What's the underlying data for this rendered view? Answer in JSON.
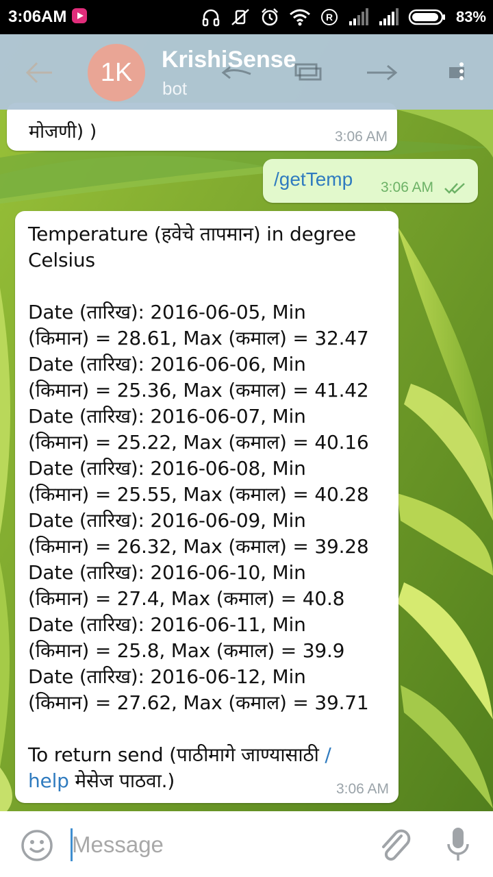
{
  "status_bar": {
    "time": "3:06AM",
    "battery_percent": "83%",
    "icons": [
      "media-app-icon",
      "headphones-icon",
      "mute-icon",
      "alarm-icon",
      "wifi-icon",
      "roaming-icon",
      "signal-icon",
      "signal-icon",
      "battery-icon"
    ]
  },
  "header": {
    "avatar_initials": "1K",
    "title": "KrishiSense",
    "subtitle": "bot",
    "avatar_color": "#e9a595",
    "bar_color": "#afc5d6"
  },
  "messages": {
    "previous": {
      "text": "मोजणी) )",
      "time": "3:06 AM"
    },
    "outgoing": {
      "text": "/getTemp",
      "time": "3:06 AM",
      "status_icon": "double-check-icon"
    },
    "incoming": {
      "title_lines": [
        "Temperature (हवेचे तापमान) in degree",
        "Celsius"
      ],
      "rows": [
        "Date (तारिख): 2016-06-05, Min",
        "(किमान) = 28.61, Max (कमाल) = 32.47",
        "Date (तारिख): 2016-06-06, Min",
        "(किमान) = 25.36, Max (कमाल) = 41.42",
        "Date (तारिख): 2016-06-07, Min",
        "(किमान) = 25.22, Max (कमाल) = 40.16",
        "Date (तारिख): 2016-06-08, Min",
        "(किमान) = 25.55, Max (कमाल) = 40.28",
        "Date (तारिख): 2016-06-09, Min",
        "(किमान) = 26.32, Max (कमाल) = 39.28",
        "Date (तारिख): 2016-06-10, Min",
        "(किमान) = 27.4, Max (कमाल) = 40.8",
        "Date (तारिख): 2016-06-11, Min",
        "(किमान) = 25.8, Max (कमाल) = 39.9",
        "Date (तारिख): 2016-06-12, Min",
        "(किमान) = 27.62, Max (कमाल) = 39.71"
      ],
      "footer_line1_text": " To return send (पाठीमागे जाण्यासाठी ",
      "footer_link_part1": "/",
      "footer_link_part2": "help",
      "footer_line2_text": " मेसेज पाठवा.)",
      "time": "3:06 AM"
    }
  },
  "input_bar": {
    "placeholder": "Message",
    "emoji_icon": "emoji-icon",
    "attach_icon": "paperclip-icon",
    "mic_icon": "microphone-icon",
    "cursor_color": "#3f8ed0"
  },
  "link_color": "#2f7bbf"
}
